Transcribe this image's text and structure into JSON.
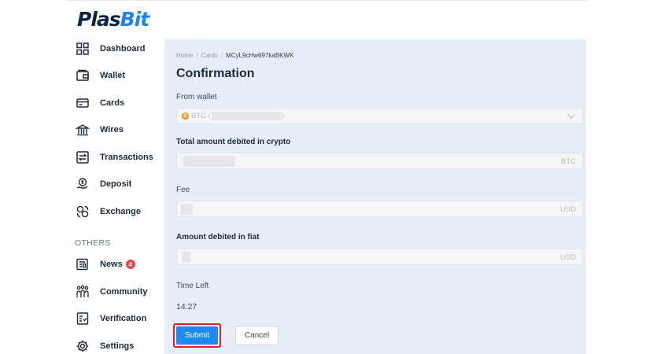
{
  "brand": {
    "part1": "Plas",
    "part2": "Bit"
  },
  "sidebar": {
    "items": [
      {
        "label": "Dashboard",
        "icon": "dashboard-grid-icon"
      },
      {
        "label": "Wallet",
        "icon": "wallet-icon"
      },
      {
        "label": "Cards",
        "icon": "card-icon"
      },
      {
        "label": "Wires",
        "icon": "bank-icon"
      },
      {
        "label": "Transactions",
        "icon": "transactions-icon"
      },
      {
        "label": "Deposit",
        "icon": "deposit-icon"
      },
      {
        "label": "Exchange",
        "icon": "exchange-icon"
      }
    ],
    "others_heading": "OTHERS",
    "other_items": [
      {
        "label": "News",
        "icon": "news-icon",
        "badge": "4"
      },
      {
        "label": "Community",
        "icon": "community-icon"
      },
      {
        "label": "Verification",
        "icon": "verification-icon"
      },
      {
        "label": "Settings",
        "icon": "gear-icon"
      }
    ]
  },
  "breadcrumb": {
    "home": "Home",
    "section": "Cards",
    "current": "MCyL9cHw697kaBKWK"
  },
  "page": {
    "title": "Confirmation"
  },
  "form": {
    "from_wallet": {
      "label": "From wallet",
      "value_prefix": "BTC (",
      "value_suffix": ")",
      "coin_symbol": "B"
    },
    "total_amount": {
      "label": "Total amount debited in crypto",
      "currency": "BTC"
    },
    "fee": {
      "label": "Fee",
      "currency": "USD"
    },
    "amount_fiat": {
      "label": "Amount debited in fiat",
      "currency": "USD"
    },
    "time_left": {
      "label": "Time Left",
      "value": "14:27"
    }
  },
  "buttons": {
    "submit": "Submit",
    "cancel": "Cancel"
  },
  "colors": {
    "accent": "#1e8af0",
    "brand_dark": "#0b2545",
    "highlight": "#e31c2b",
    "badge": "#f0454b",
    "bitcoin": "#f7931a"
  }
}
